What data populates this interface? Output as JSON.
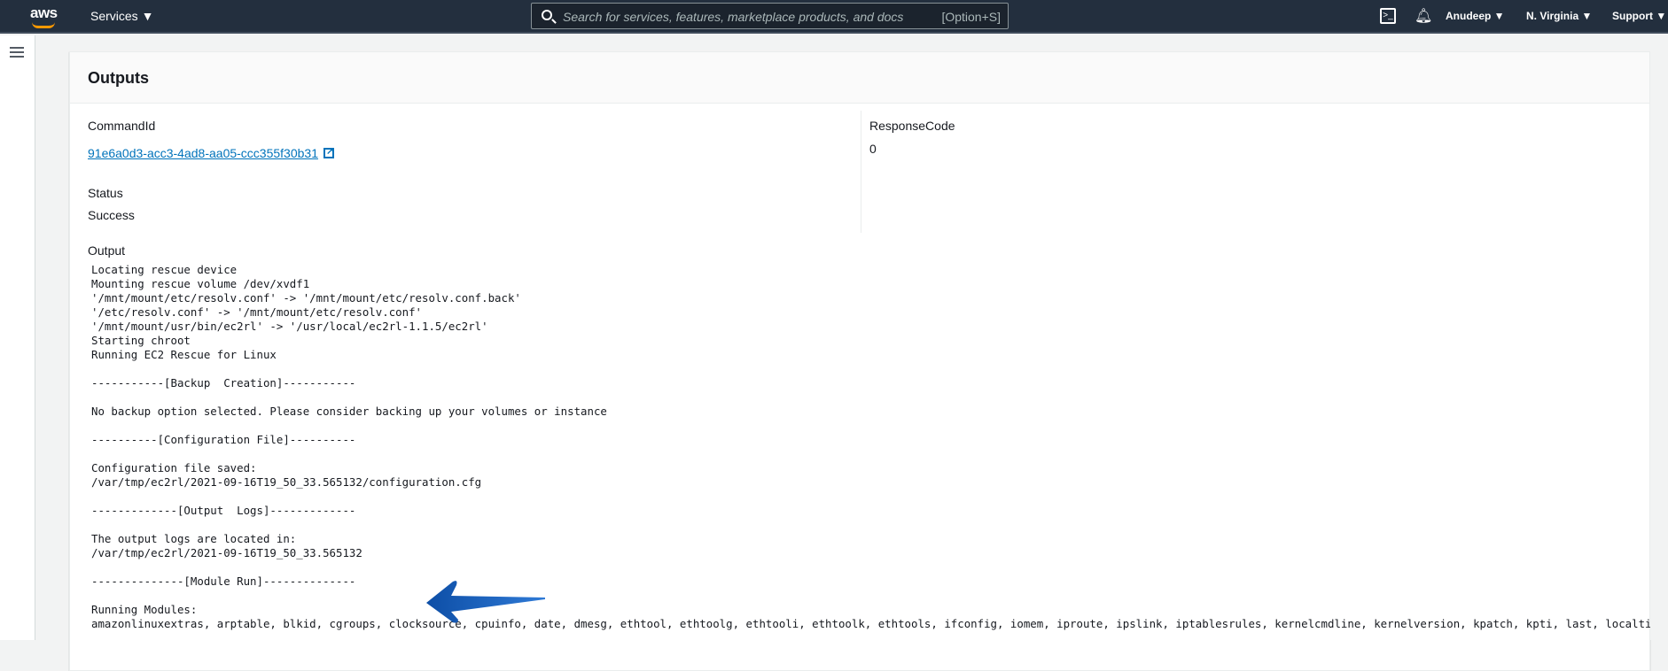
{
  "topbar": {
    "logo": "aws",
    "services": "Services ▼",
    "search_placeholder": "Search for services, features, marketplace products, and docs",
    "search_shortcut": "[Option+S]",
    "user": "Anudeep ▼",
    "region": "N. Virginia ▼",
    "support": "Support ▼"
  },
  "panel": {
    "title": "Outputs",
    "command_id_label": "CommandId",
    "command_id": "91e6a0d3-acc3-4ad8-aa05-ccc355f30b31",
    "status_label": "Status",
    "status": "Success",
    "response_code_label": "ResponseCode",
    "response_code": "0",
    "output_label": "Output",
    "output": "Locating rescue device\nMounting rescue volume /dev/xvdf1\n'/mnt/mount/etc/resolv.conf' -> '/mnt/mount/etc/resolv.conf.back'\n'/etc/resolv.conf' -> '/mnt/mount/etc/resolv.conf'\n'/mnt/mount/usr/bin/ec2rl' -> '/usr/local/ec2rl-1.1.5/ec2rl'\nStarting chroot\nRunning EC2 Rescue for Linux\n\n-----------[Backup  Creation]-----------\n\nNo backup option selected. Please consider backing up your volumes or instance\n\n----------[Configuration File]----------\n\nConfiguration file saved:\n/var/tmp/ec2rl/2021-09-16T19_50_33.565132/configuration.cfg\n\n-------------[Output  Logs]-------------\n\nThe output logs are located in:\n/var/tmp/ec2rl/2021-09-16T19_50_33.565132\n\n--------------[Module Run]--------------\n\nRunning Modules:\namazonlinuxextras, arptable, blkid, cgroups, clocksource, cpuinfo, date, dmesg, ethtool, ethtoolg, ethtooli, ethtoolk, ethtools, ifconfig, iomem, iproute, ipslink, iptablesrules, kernelcmdline, kernelversion, kpatch, kpti, last, localtime, ls"
  },
  "colors": {
    "topbar": "#232f3e",
    "link": "#0073bb",
    "arrow": "#1a5fbf"
  }
}
